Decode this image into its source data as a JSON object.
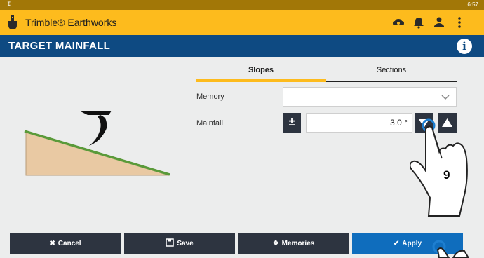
{
  "status_bar": {
    "time": "6:57"
  },
  "app_bar": {
    "app_name": "Trimble® Earthworks",
    "icons": [
      "cloud-icon",
      "bell-icon",
      "user-icon",
      "more-vert-icon"
    ]
  },
  "title_bar": {
    "title": "TARGET MAINFALL",
    "info_icon": "i"
  },
  "tabs": [
    {
      "label": "Slopes",
      "active": true
    },
    {
      "label": "Sections",
      "active": false
    }
  ],
  "form": {
    "memory": {
      "label": "Memory",
      "value": ""
    },
    "mainfall": {
      "label": "Mainfall",
      "value": "3.0 °",
      "toggle_sign": "±"
    }
  },
  "bottom_buttons": {
    "cancel": "Cancel",
    "save": "Save",
    "memories": "Memories",
    "apply": "Apply"
  },
  "annotation": {
    "step_number": "9"
  },
  "colors": {
    "accent_yellow": "#fdbb1d",
    "header_blue": "#0e4a82",
    "button_dark": "#2d3440",
    "apply_blue": "#0f6dbd",
    "slope_line": "#5a9a3a",
    "slope_fill": "#e9c9a3"
  }
}
